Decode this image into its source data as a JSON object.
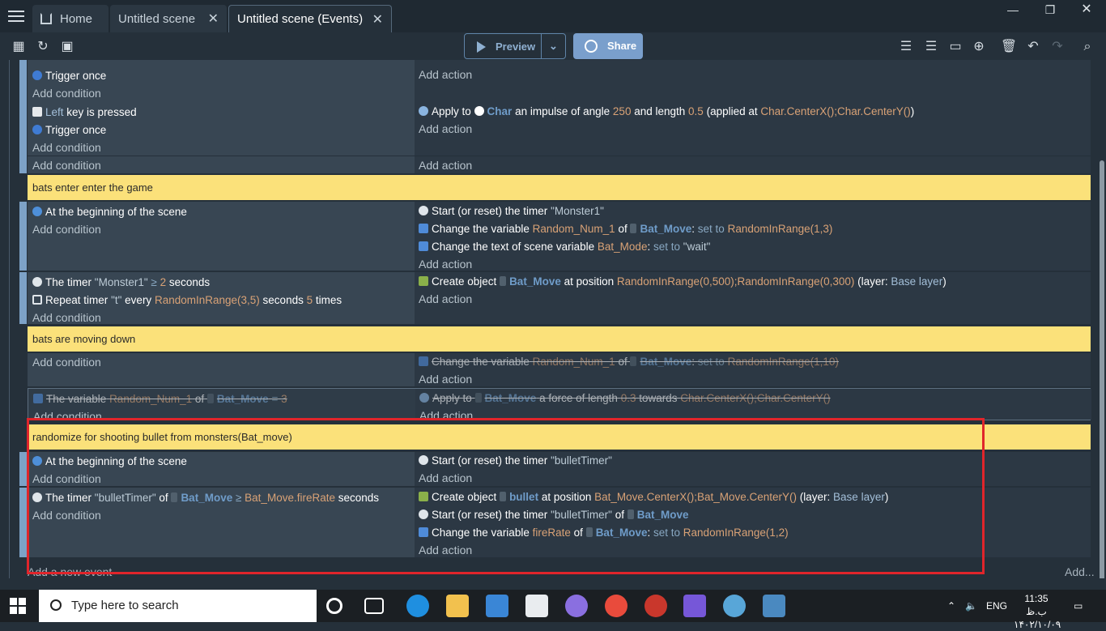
{
  "tabs": [
    {
      "label": "Home"
    },
    {
      "label": "Untitled scene"
    },
    {
      "label": "Untitled scene (Events)"
    }
  ],
  "toolbar": {
    "preview_label": "Preview",
    "share_label": "Share"
  },
  "events": {
    "r0": {
      "c1": "Trigger once",
      "add_cond": "Add condition",
      "add_act": "Add action"
    },
    "r1": {
      "key": "Left",
      "key_rest": "key is pressed",
      "c2": "Trigger once",
      "add_cond": "Add condition",
      "a1_pre": "Apply to",
      "a1_obj": "Char",
      "a1_mid": "an impulse of angle",
      "a1_angle": "250",
      "a1_and": "and length",
      "a1_len": "0.5",
      "a1_app": "(applied at",
      "a1_pos": "Char.CenterX();Char.CenterY()",
      "a1_end": ")",
      "add_act": "Add action"
    },
    "r1b": {
      "add_cond": "Add condition",
      "add_act": "Add action"
    },
    "comment1": "bats enter enter the game",
    "r2": {
      "c1": "At the beginning of the scene",
      "add_cond": "Add condition",
      "a1_pre": "Start (or reset) the timer",
      "a1_val": "\"Monster1\"",
      "a2_pre": "Change the variable",
      "a2_var": "Random_Num_1",
      "a2_of": "of",
      "a2_obj": "Bat_Move",
      "a2_colon": ":",
      "a2_set": "set to",
      "a2_val": "RandomInRange(1,3)",
      "a3_pre": "Change the text of scene variable",
      "a3_var": "Bat_Mode",
      "a3_colon": ":",
      "a3_set": "set to",
      "a3_val": "\"wait\"",
      "add_act": "Add action"
    },
    "r3": {
      "c1_pre": "The timer",
      "c1_val": "\"Monster1\"",
      "c1_op": "≥",
      "c1_num": "2",
      "c1_unit": "seconds",
      "c2_pre": "Repeat timer",
      "c2_val": "\"t\"",
      "c2_every": "every",
      "c2_range": "RandomInRange(3,5)",
      "c2_sec": "seconds",
      "c2_num": "5",
      "c2_times": "times",
      "add_cond": "Add condition",
      "a1_pre": "Create object",
      "a1_obj": "Bat_Move",
      "a1_at": "at position",
      "a1_pos": "RandomInRange(0,500);RandomInRange(0,300)",
      "a1_layer": "(layer:",
      "a1_layer_val": "Base layer",
      "a1_end": ")",
      "add_act": "Add action"
    },
    "comment2": "bats are moving down",
    "r4": {
      "add_cond": "Add condition",
      "a1_pre": "Change the variable",
      "a1_var": "Random_Num_1",
      "a1_of": "of",
      "a1_obj": "Bat_Move",
      "a1_colon": ":",
      "a1_set": "set to",
      "a1_val": "RandomInRange(1,10)",
      "add_act": "Add action"
    },
    "r5": {
      "c1_pre": "The variable",
      "c1_var": "Random_Num_1",
      "c1_of": "of",
      "c1_obj": "Bat_Move",
      "c1_op": "=",
      "c1_val": "3",
      "add_cond": "Add condition",
      "a1_pre": "Apply to",
      "a1_obj": "Bat_Move",
      "a1_mid": "a force of length",
      "a1_len": "0.3",
      "a1_tow": "towards",
      "a1_pos": "Char.CenterX();Char.CenterY()",
      "add_act": "Add action"
    },
    "comment3": "randomize for shooting bullet from monsters(Bat_move)",
    "r6": {
      "c1": "At the beginning of the scene",
      "add_cond": "Add condition",
      "a1_pre": "Start (or reset) the timer",
      "a1_val": "\"bulletTimer\"",
      "add_act": "Add action"
    },
    "r7": {
      "c1_pre": "The timer",
      "c1_val": "\"bulletTimer\"",
      "c1_of": "of",
      "c1_obj": "Bat_Move",
      "c1_op": "≥",
      "c1_rate": "Bat_Move.fireRate",
      "c1_unit": "seconds",
      "add_cond": "Add condition",
      "a1_pre": "Create object",
      "a1_obj": "bullet",
      "a1_at": "at position",
      "a1_pos": "Bat_Move.CenterX();Bat_Move.CenterY()",
      "a1_layer": "(layer:",
      "a1_layer_val": "Base layer",
      "a1_end": ")",
      "a2_pre": "Start (or reset) the timer",
      "a2_val": "\"bulletTimer\"",
      "a2_of": "of",
      "a2_obj": "Bat_Move",
      "a3_pre": "Change the variable",
      "a3_var": "fireRate",
      "a3_of": "of",
      "a3_obj": "Bat_Move",
      "a3_colon": ":",
      "a3_set": "set to",
      "a3_val": "RandomInRange(1,2)",
      "add_act": "Add action"
    },
    "add_new_event": "Add a new event",
    "add_more": "Add..."
  },
  "taskbar": {
    "search_placeholder": "Type here to search",
    "lang": "ENG",
    "time": "11:35 ب.ظ",
    "date": "۱۴۰۲/۱۰/۰۹"
  },
  "colors": {
    "accent": "#7a9fcc",
    "comment": "#fbe17a",
    "highlight": "#e0252b"
  }
}
